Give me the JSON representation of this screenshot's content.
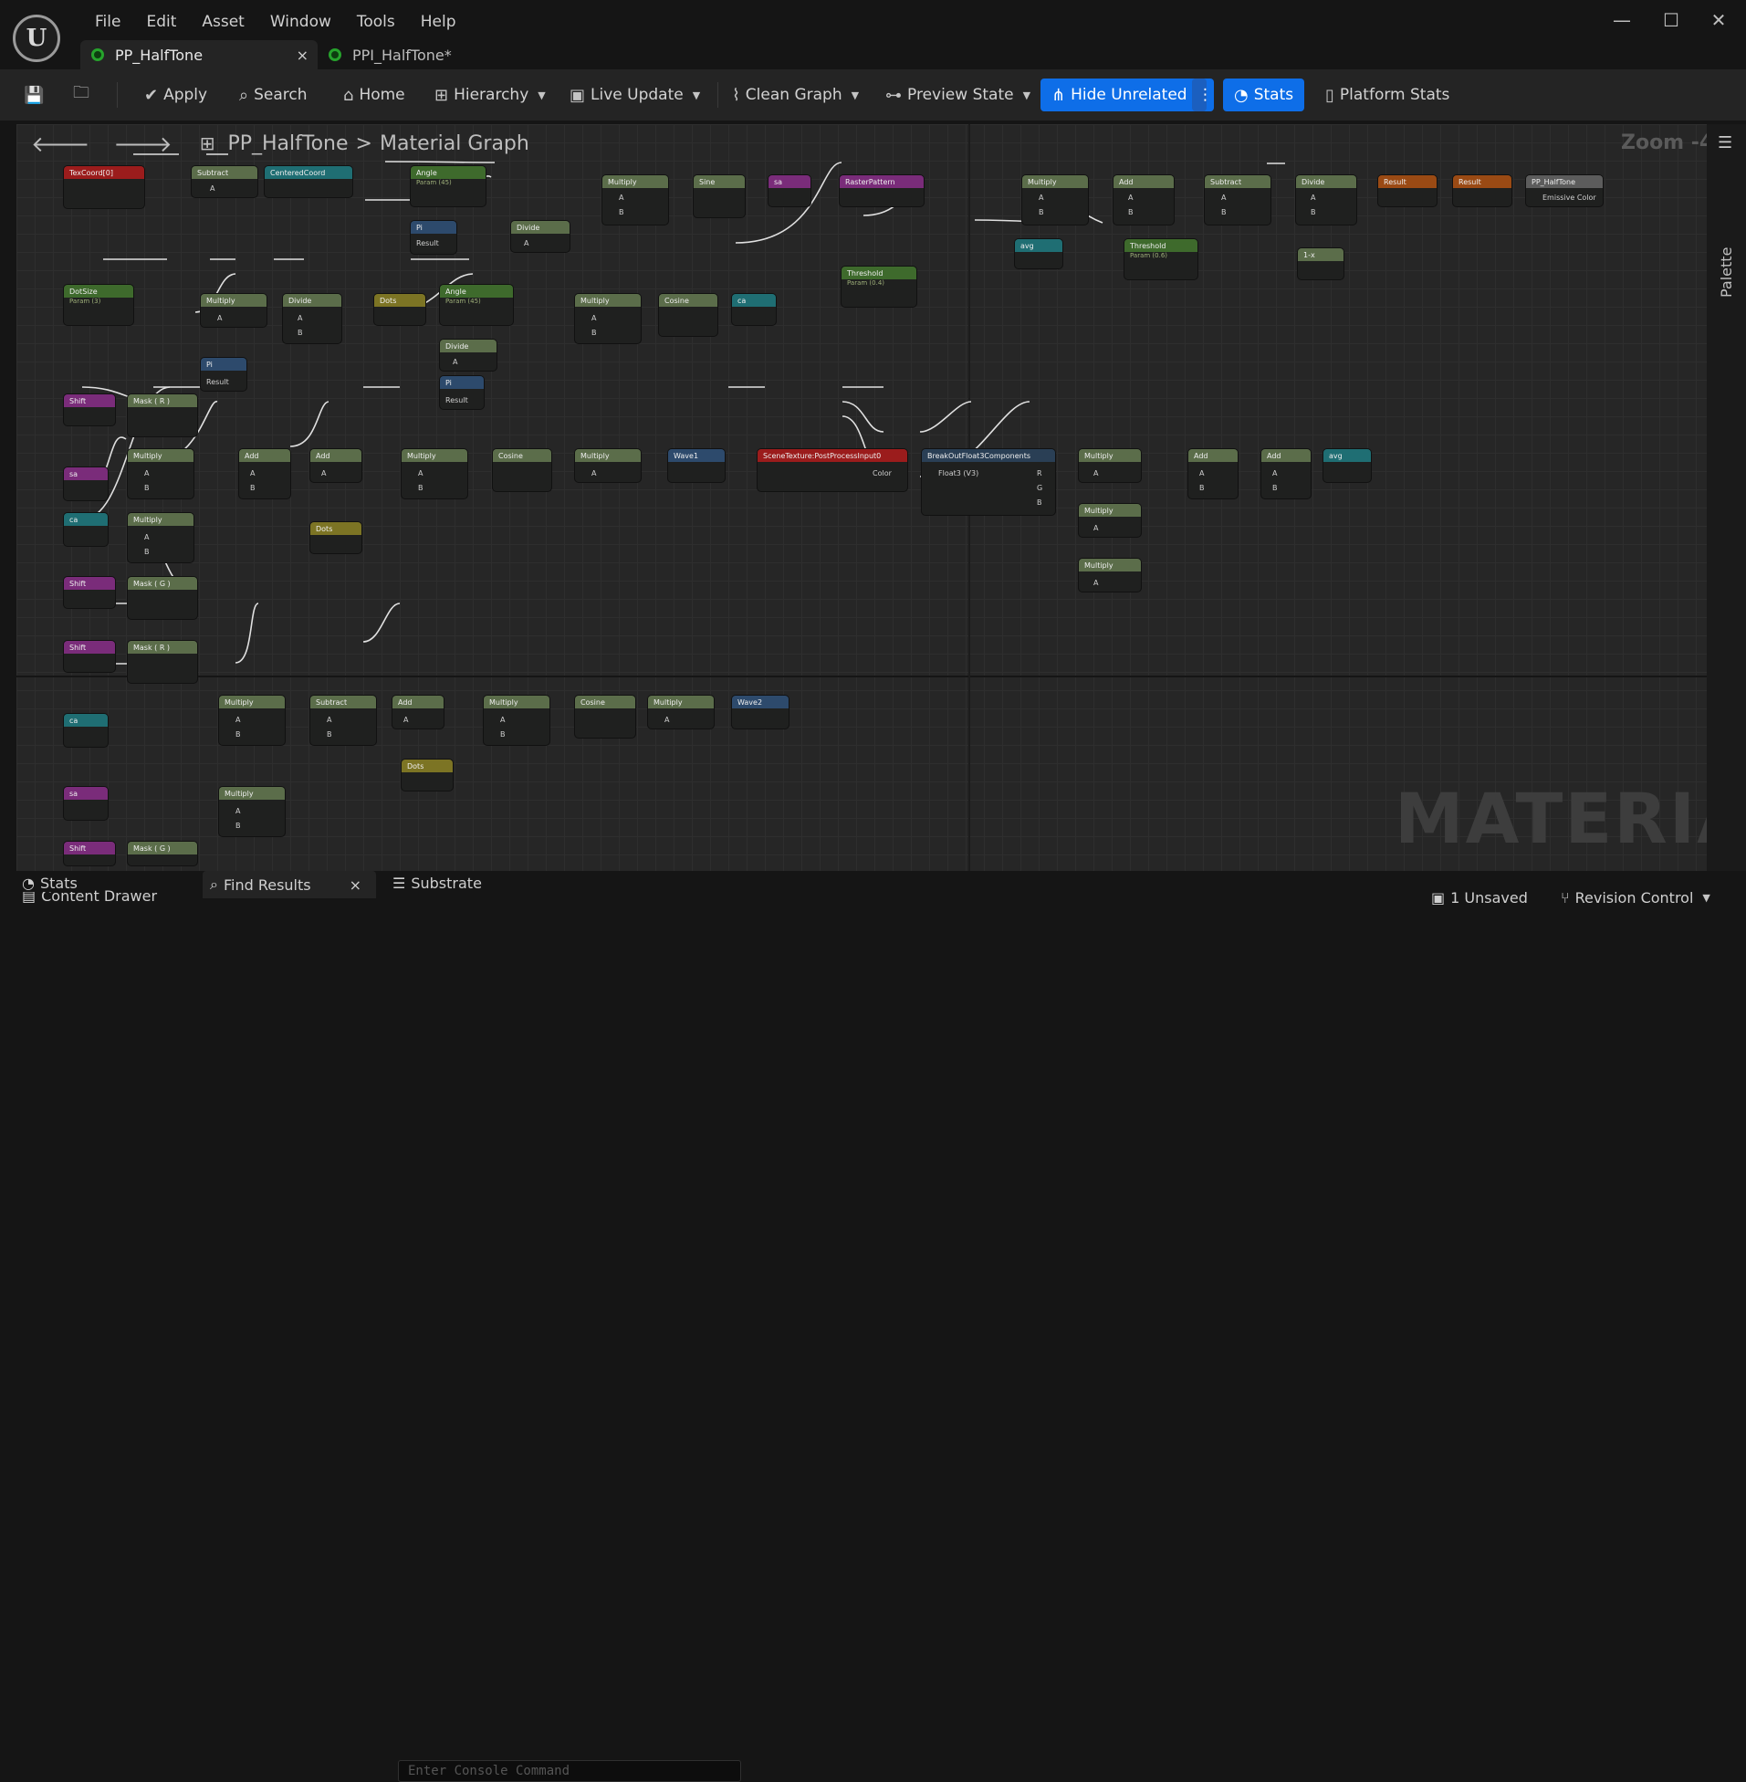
{
  "app": {
    "logo": "U"
  },
  "menu": [
    "File",
    "Edit",
    "Asset",
    "Window",
    "Tools",
    "Help"
  ],
  "tabs": [
    {
      "label": "PP_HalfTone",
      "close": "×"
    },
    {
      "label": "PPI_HalfTone*"
    }
  ],
  "toolbar": {
    "apply": "Apply",
    "search": "Search",
    "home": "Home",
    "hierarchy": "Hierarchy",
    "live_update": "Live Update",
    "clean_graph": "Clean Graph",
    "preview_state": "Preview State",
    "hide_unrelated": "Hide Unrelated",
    "stats": "Stats",
    "platform_stats": "Platform Stats",
    "more": "⋮"
  },
  "breadcrumb": {
    "asset": "PP_HalfTone",
    "sep": ">",
    "graph": "Material Graph"
  },
  "zoom": "Zoom -4",
  "watermark": "MATERIAL",
  "palette": "Palette",
  "status": {
    "content_drawer": "Content Drawer",
    "stats_tab": "Stats",
    "find_results": "Find Results",
    "find_close": "×",
    "substrate": "Substrate",
    "console_placeholder": "Enter Console Command",
    "unsaved": "1 Unsaved",
    "revision": "Revision Control"
  },
  "colors": {
    "accent_blue": "#0e6ee8",
    "graph_bg": "#262626"
  },
  "nodes": {
    "texcoord": "TexCoord[0]",
    "subtract": "Subtract",
    "centeredcoord": "CenteredCoord",
    "angle": "Angle",
    "angle_param": "Param (45)",
    "pi": "Pi",
    "result": "Result",
    "divide": "Divide",
    "multiply": "Multiply",
    "sine": "Sine",
    "sa": "sa",
    "rasterpattern": "RasterPattern",
    "add": "Add",
    "pp_halftone": "PP_HalfTone",
    "emissive": "Emissive Color",
    "avg": "avg",
    "threshold": "Threshold",
    "threshold_param_a": "Param (0.6)",
    "threshold_param_b": "Param (0.4)",
    "one_minus": "1-x",
    "dotsize": "DotSize",
    "dotsize_param": "Param (3)",
    "dots": "Dots",
    "cosine": "Cosine",
    "ca": "ca",
    "shift": "Shift",
    "mask_r": "Mask ( R )",
    "mask_g": "Mask ( G )",
    "wave1": "Wave1",
    "wave2": "Wave2",
    "scenetexture": "SceneTexture:PostProcessInput0",
    "color": "Color",
    "breakout": "BreakOutFloat3Components",
    "float3": "Float3 (V3)",
    "pin_a": "A",
    "pin_b": "B",
    "pin_r": "R",
    "pin_g": "G",
    "pin_bb": "B"
  }
}
